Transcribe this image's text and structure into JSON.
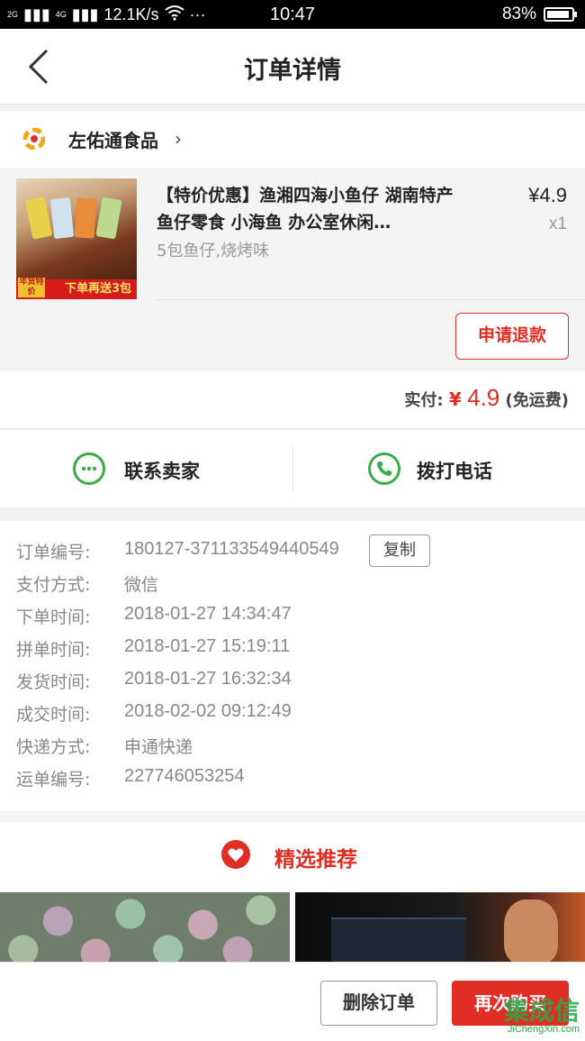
{
  "status_bar": {
    "signal_left": "2G",
    "signal_right": "4G",
    "net_speed": "12.1K/s",
    "more": "···",
    "time": "10:47",
    "battery": "83%"
  },
  "nav": {
    "title": "订单详情"
  },
  "shop": {
    "name": "左佑通食品"
  },
  "product": {
    "title": "【特价优惠】渔湘四海小鱼仔 湖南特产 鱼仔零食 小海鱼 办公室休闲…",
    "spec": "5包鱼仔,烧烤味",
    "price": "¥4.9",
    "qty": "x1",
    "thumb_banner": "下单再送3包",
    "thumb_tag": "年货特价",
    "refund_label": "申请退款"
  },
  "payment": {
    "label": "实付:",
    "currency": "¥",
    "amount": "4.9",
    "note": "(免运费)"
  },
  "contact": {
    "seller_label": "联系卖家",
    "phone_label": "拨打电话"
  },
  "order_info": {
    "copy_label": "复制",
    "rows": [
      {
        "key": "订单编号:",
        "value": "180127-371133549440549"
      },
      {
        "key": "支付方式:",
        "value": "微信"
      },
      {
        "key": "下单时间:",
        "value": "2018-01-27 14:34:47"
      },
      {
        "key": "拼单时间:",
        "value": "2018-01-27 15:19:11"
      },
      {
        "key": "发货时间:",
        "value": "2018-01-27 16:32:34"
      },
      {
        "key": "成交时间:",
        "value": "2018-02-02 09:12:49"
      },
      {
        "key": "快递方式:",
        "value": "申通快递"
      },
      {
        "key": "运单编号:",
        "value": "227746053254"
      }
    ]
  },
  "recommend": {
    "title": "精选推荐"
  },
  "actions": {
    "delete_label": "删除订单",
    "buy_again_label": "再次购买"
  },
  "watermark": {
    "main": "集成信",
    "sub": "JiChengXin.com"
  },
  "colors": {
    "accent": "#e02e24",
    "wechat_green": "#3aad45"
  }
}
